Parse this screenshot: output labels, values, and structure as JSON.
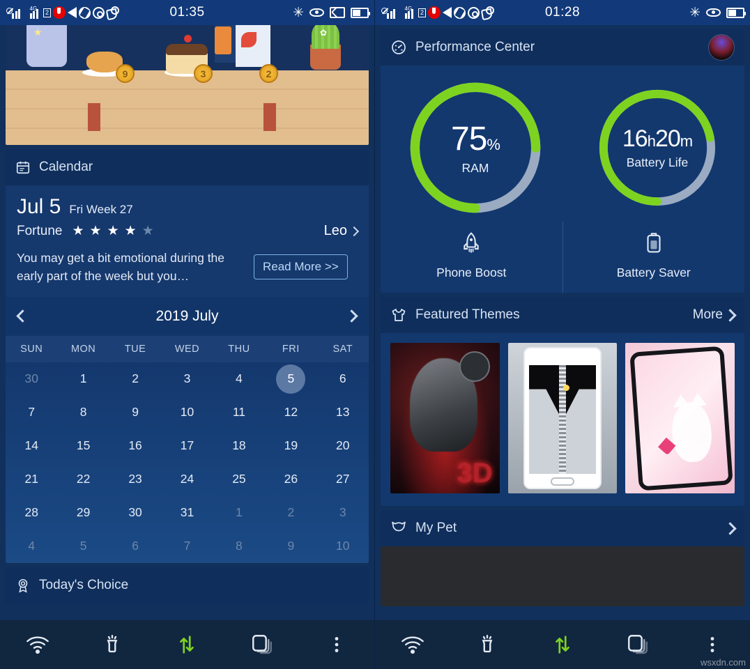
{
  "left": {
    "statusbar": {
      "time": "01:35",
      "left_icons": [
        "signal-blocked-icon",
        "signal-4g-icon",
        "sim2-badge",
        "vodafone-icon",
        "volume-icon",
        "shutter-icon",
        "target-icon",
        "call-waiting-icon"
      ],
      "right_icons": [
        "bluetooth-icon",
        "eye-icon",
        "cast-icon",
        "battery-icon"
      ],
      "sim_label": "2",
      "net_label": "4G"
    },
    "game": {
      "coins": [
        "9",
        "3",
        "2"
      ]
    },
    "calendar": {
      "title": "Calendar",
      "icon": "calendar-icon",
      "date_main": "Jul 5",
      "date_sub": "Fri Week 27",
      "fortune_label": "Fortune",
      "stars_filled": 4,
      "stars_total": 5,
      "zodiac": "Leo",
      "fortune_text": "You may get a bit emotional during the early part of the week but you…",
      "read_more": "Read More >>",
      "month_title": "2019 July",
      "dow": [
        "SUN",
        "MON",
        "TUE",
        "WED",
        "THU",
        "FRI",
        "SAT"
      ],
      "weeks": [
        [
          {
            "d": "30",
            "dim": true
          },
          {
            "d": "1"
          },
          {
            "d": "2"
          },
          {
            "d": "3"
          },
          {
            "d": "4"
          },
          {
            "d": "5",
            "today": true
          },
          {
            "d": "6"
          }
        ],
        [
          {
            "d": "7"
          },
          {
            "d": "8"
          },
          {
            "d": "9"
          },
          {
            "d": "10"
          },
          {
            "d": "11"
          },
          {
            "d": "12"
          },
          {
            "d": "13"
          }
        ],
        [
          {
            "d": "14"
          },
          {
            "d": "15"
          },
          {
            "d": "16"
          },
          {
            "d": "17"
          },
          {
            "d": "18"
          },
          {
            "d": "19"
          },
          {
            "d": "20"
          }
        ],
        [
          {
            "d": "21"
          },
          {
            "d": "22"
          },
          {
            "d": "23"
          },
          {
            "d": "24"
          },
          {
            "d": "25"
          },
          {
            "d": "26"
          },
          {
            "d": "27"
          }
        ],
        [
          {
            "d": "28"
          },
          {
            "d": "29"
          },
          {
            "d": "30"
          },
          {
            "d": "31"
          },
          {
            "d": "1",
            "dim": true
          },
          {
            "d": "2",
            "dim": true
          },
          {
            "d": "3",
            "dim": true
          }
        ],
        [
          {
            "d": "4",
            "dim": true
          },
          {
            "d": "5",
            "dim": true
          },
          {
            "d": "6",
            "dim": true
          },
          {
            "d": "7",
            "dim": true
          },
          {
            "d": "8",
            "dim": true
          },
          {
            "d": "9",
            "dim": true
          },
          {
            "d": "10",
            "dim": true
          }
        ]
      ]
    },
    "todays_choice": {
      "title": "Today's Choice",
      "icon": "award-icon"
    },
    "navbar": [
      "wifi-icon",
      "flashlight-icon",
      "data-transfer-icon",
      "recent-apps-icon",
      "overflow-menu-icon"
    ]
  },
  "right": {
    "statusbar": {
      "time": "01:28",
      "left_icons": [
        "signal-blocked-icon",
        "signal-4g-icon",
        "sim2-badge",
        "vodafone-icon",
        "volume-icon",
        "shutter-icon",
        "target-icon",
        "call-waiting-icon"
      ],
      "right_icons": [
        "bluetooth-icon",
        "eye-icon",
        "battery-icon"
      ],
      "sim_label": "2",
      "net_label": "4G"
    },
    "performance": {
      "title": "Performance Center",
      "icon": "speedometer-icon",
      "avatar": "user-avatar",
      "ram": {
        "value": "75",
        "unit": "%",
        "caption": "RAM",
        "percent": 75
      },
      "battery": {
        "hours": "16",
        "h_unit": "h",
        "minutes": "20",
        "m_unit": "m",
        "caption": "Battery Life",
        "percent": 72
      },
      "actions": [
        {
          "label": "Phone Boost",
          "icon": "rocket-icon"
        },
        {
          "label": "Battery Saver",
          "icon": "battery-saver-icon"
        }
      ]
    },
    "themes": {
      "title": "Featured Themes",
      "icon": "tshirt-icon",
      "more": "More",
      "items": [
        {
          "name": "warrior-3d-theme"
        },
        {
          "name": "diamond-zipper-theme"
        },
        {
          "name": "pink-kitty-theme"
        }
      ]
    },
    "mypet": {
      "title": "My Pet",
      "icon": "pet-bear-icon"
    },
    "navbar": [
      "wifi-icon",
      "flashlight-icon",
      "data-transfer-icon",
      "recent-apps-icon",
      "overflow-menu-icon"
    ],
    "watermark": "wsxdn.com"
  },
  "colors": {
    "accent_green": "#7ed321",
    "ring_track": "#9aabc2",
    "panel": "#13386e",
    "header": "#0f2e5c",
    "statusbar": "#123a7a",
    "navbar": "#11263f",
    "link": "#bcd9f7"
  }
}
